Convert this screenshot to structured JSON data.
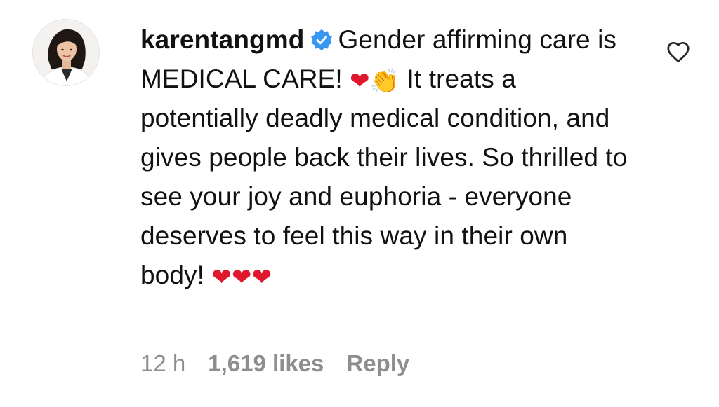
{
  "comment": {
    "username": "karentangmd",
    "verified_icon": "verified-badge-icon",
    "text_part1": "Gender affirming care is MEDICAL CARE! ",
    "emoji_heart": "❤",
    "emoji_clap": "👏",
    "text_part2": " It treats a potentially deadly medical condition, and gives people back their lives. So thrilled to see your joy and euphoria - everyone deserves to feel this way in their own body! ",
    "emoji_hearts_end": "❤❤❤",
    "time": "12 h",
    "likes": "1,619 likes",
    "reply_label": "Reply",
    "like_icon": "heart-outline-icon",
    "accent_color": "#3897f0"
  }
}
